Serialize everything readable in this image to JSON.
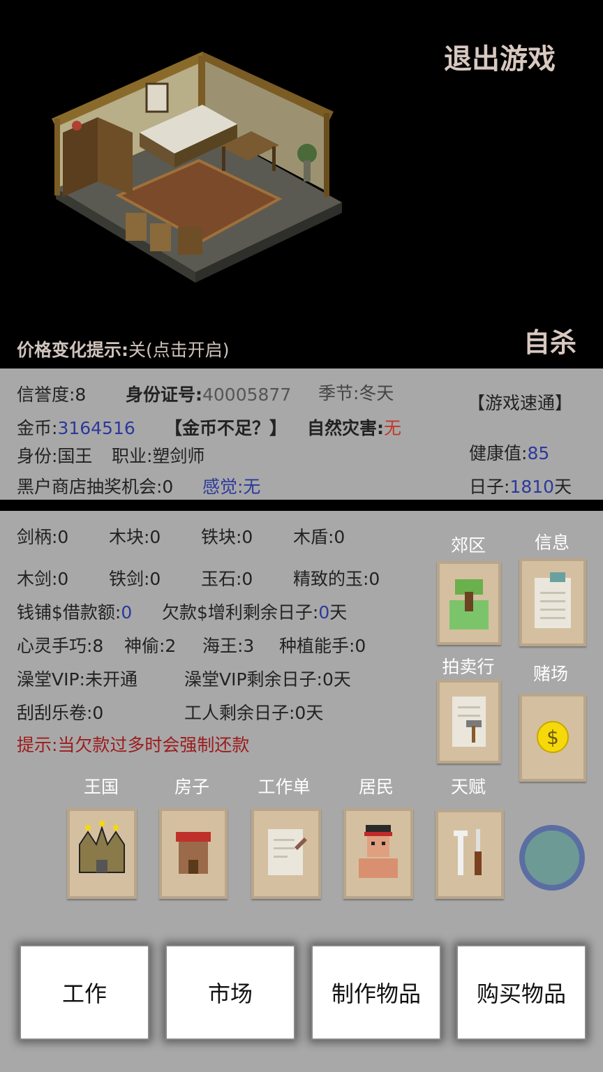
{
  "top": {
    "exit_label": "退出游戏",
    "suicide_label": "自杀",
    "price_tip_label": "价格变化提示:",
    "price_tip_value": "关(点击开启)"
  },
  "stats": {
    "credit": "信誉度:8",
    "id_label": "身份证号:",
    "id_value": "40005877",
    "season": "季节:冬天",
    "speedrun": "【游戏速通】",
    "gold_label": "金币:",
    "gold_value": "3164516",
    "gold_short": "【金币不足？】",
    "disaster_label": "自然灾害:",
    "disaster_value": "无",
    "identity": "身份:国王",
    "job": "职业:塑剑师",
    "health_label": "健康值:",
    "health_value": "85",
    "blackshop": "黑户商店抽奖机会:0",
    "feeling": "感觉:无",
    "days_label": "日子:",
    "days_value": "1810",
    "days_unit": "天"
  },
  "inventory": {
    "r1": [
      "剑柄:0",
      "木块:0",
      "铁块:0",
      "木盾:0"
    ],
    "r2": [
      "木剑:0",
      "铁剑:0",
      "玉石:0",
      "精致的玉:0"
    ],
    "loan_label": "钱铺$借款额:",
    "loan_value": "0",
    "debt_label": "欠款$增利剩余日子:",
    "debt_value": "0",
    "debt_unit": "天",
    "skills": [
      "心灵手巧:8",
      "神偷:2",
      "海王:3",
      "种植能手:0"
    ],
    "bath_vip": "澡堂VIP:未开通",
    "bath_days": "澡堂VIP剩余日子:0天",
    "scratch": "刮刮乐卷:0",
    "worker_days": "工人剩余日子:0天",
    "hint": "提示:当欠款过多时会强制还款"
  },
  "side_tiles": {
    "suburb": "郊区",
    "info": "信息",
    "auction": "拍卖行",
    "casino": "赌场"
  },
  "bottom_tiles": {
    "kingdom": "王国",
    "house": "房子",
    "worksheet": "工作单",
    "residents": "居民",
    "talent": "天赋"
  },
  "actions": {
    "work": "工作",
    "market": "市场",
    "craft": "制作物品",
    "buy": "购买物品"
  },
  "colors": {
    "panel": "#a9a8a9",
    "blue_value": "#2b3a9a",
    "red_value": "#c0392b",
    "hint": "#9b1c1c",
    "tile": "#d4c0a0"
  }
}
